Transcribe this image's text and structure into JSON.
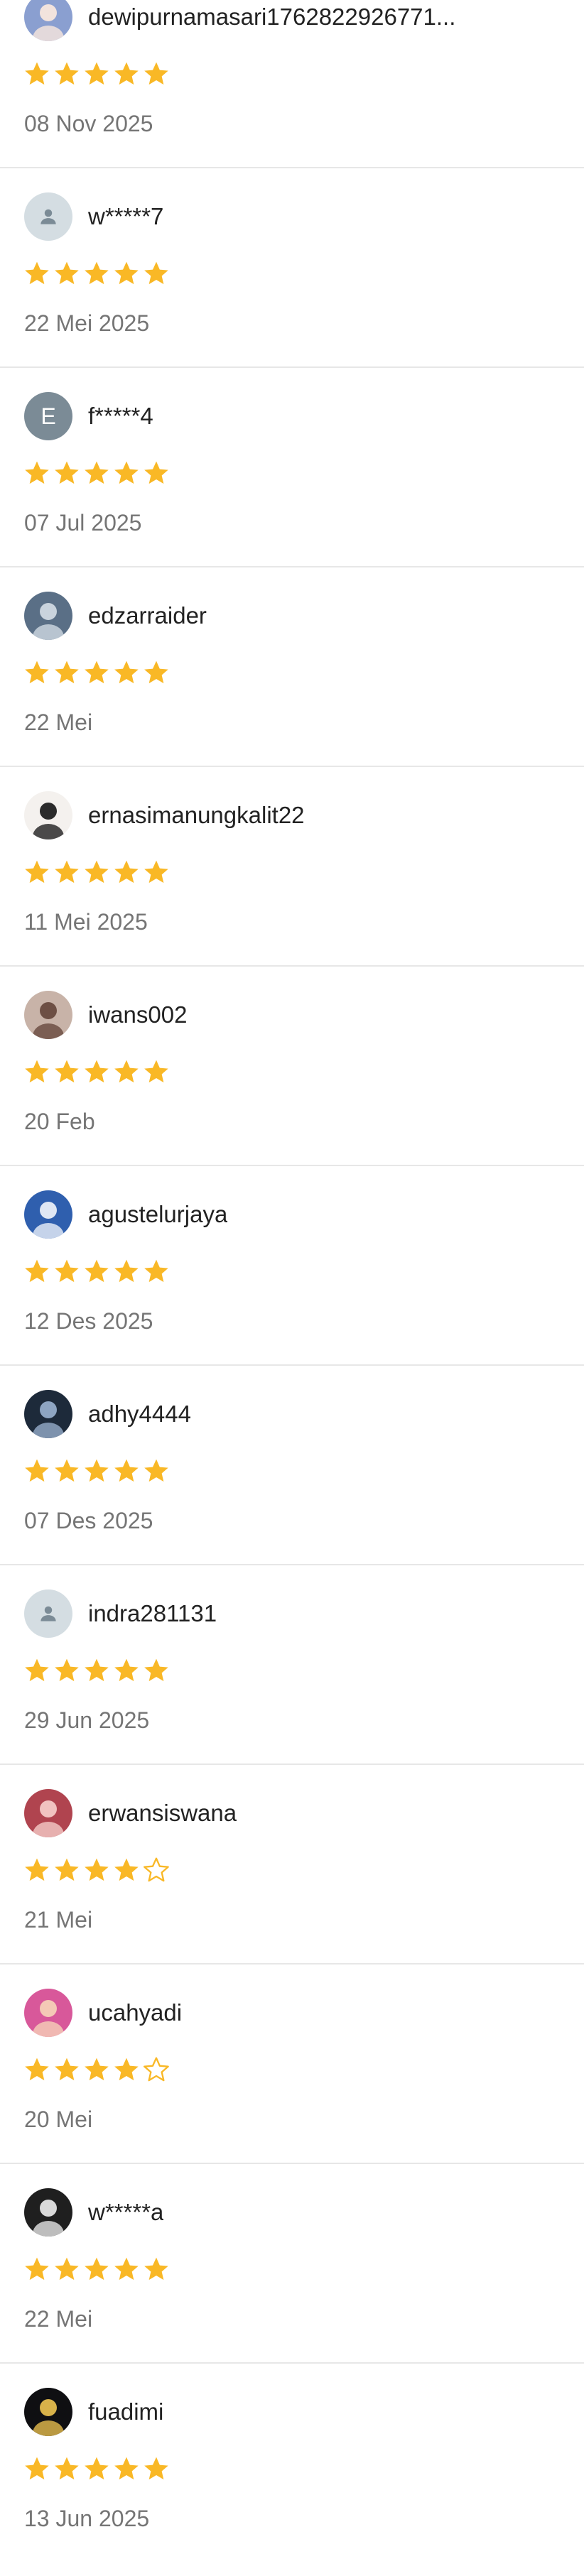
{
  "colors": {
    "star_filled": "#F9B826",
    "star_empty_stroke": "#F9B826",
    "text_primary": "#222222",
    "text_secondary": "#757575",
    "divider": "#E7E7E7"
  },
  "reviews": [
    {
      "username": "dewipurnamasari1762822926771...",
      "rating": 5,
      "date": "08 Nov 2025",
      "avatar": {
        "type": "photo",
        "bg": "#8a9fd0",
        "fg": "#f2e3dd"
      }
    },
    {
      "username": "w*****7",
      "rating": 5,
      "date": "22 Mei 2025",
      "avatar": {
        "type": "placeholder-icon"
      }
    },
    {
      "username": "f*****4",
      "rating": 5,
      "date": "07 Jul 2025",
      "avatar": {
        "type": "letter",
        "letter": "E"
      }
    },
    {
      "username": "edzarraider",
      "rating": 5,
      "date": "22 Mei",
      "avatar": {
        "type": "photo",
        "bg": "#5a6f86",
        "fg": "#c9d3dd"
      }
    },
    {
      "username": "ernasimanungkalit22",
      "rating": 5,
      "date": "11 Mei 2025",
      "avatar": {
        "type": "photo",
        "bg": "#f4f1ee",
        "fg": "#2b2b2b"
      }
    },
    {
      "username": "iwans002",
      "rating": 5,
      "date": "20 Feb",
      "avatar": {
        "type": "photo",
        "bg": "#c8b3a8",
        "fg": "#6d4f44"
      }
    },
    {
      "username": "agustelurjaya",
      "rating": 5,
      "date": "12 Des 2025",
      "avatar": {
        "type": "photo",
        "bg": "#2f5fae",
        "fg": "#dfe7f4"
      }
    },
    {
      "username": "adhy4444",
      "rating": 5,
      "date": "07 Des 2025",
      "avatar": {
        "type": "photo",
        "bg": "#1d2a3a",
        "fg": "#8ea5c2"
      }
    },
    {
      "username": "indra281131",
      "rating": 5,
      "date": "29 Jun 2025",
      "avatar": {
        "type": "placeholder-icon"
      }
    },
    {
      "username": "erwansiswana",
      "rating": 4,
      "date": "21 Mei",
      "avatar": {
        "type": "photo",
        "bg": "#b0444f",
        "fg": "#f1c3c0"
      }
    },
    {
      "username": "ucahyadi",
      "rating": 4,
      "date": "20 Mei",
      "avatar": {
        "type": "photo",
        "bg": "#d8589a",
        "fg": "#f4c9b6"
      }
    },
    {
      "username": "w*****a",
      "rating": 5,
      "date": "22 Mei",
      "avatar": {
        "type": "photo",
        "bg": "#1f1f1f",
        "fg": "#d9d9d9"
      }
    },
    {
      "username": "fuadimi",
      "rating": 5,
      "date": "13 Jun 2025",
      "avatar": {
        "type": "photo",
        "bg": "#0f0f12",
        "fg": "#d8b24a"
      }
    }
  ]
}
